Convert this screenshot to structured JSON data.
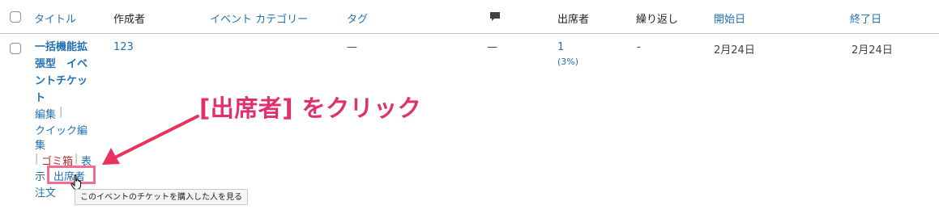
{
  "header": {
    "title": "タイトル",
    "author": "作成者",
    "event_category": "イベント カテゴリー",
    "tags": "タグ",
    "attendees": "出席者",
    "repeat": "繰り返し",
    "start_date": "開始日",
    "end_date": "終了日"
  },
  "row": {
    "title_lines": [
      "一括機能拡",
      "張型　イベ",
      "ントチケッ",
      "ト"
    ],
    "author": "123",
    "event_category": "",
    "tags": "—",
    "comments": "—",
    "attendees_count": "1",
    "attendees_percent": "(3%)",
    "repeat": "-",
    "start_date": "2月24日",
    "end_date": "2月24日",
    "actions": {
      "edit": "編集",
      "quick_edit_1": "クイック編",
      "quick_edit_2": "集",
      "trash": "ゴミ箱",
      "view_1": "表",
      "view_2": "示",
      "attendees": "出席者",
      "orders": "注文",
      "separator": "|"
    }
  },
  "callout_text": "[出席者] をクリック",
  "tooltip_text": "このイベントのチケットを購入した人を見る",
  "colors": {
    "link": "#2271b1",
    "trash": "#b32d2e",
    "callout": "#e0306e",
    "highlight": "#f06d95",
    "arrow": "#e8335f"
  },
  "icons": {
    "comment_header": "comment-bubble-icon",
    "cursor": "hand-pointer-icon"
  }
}
